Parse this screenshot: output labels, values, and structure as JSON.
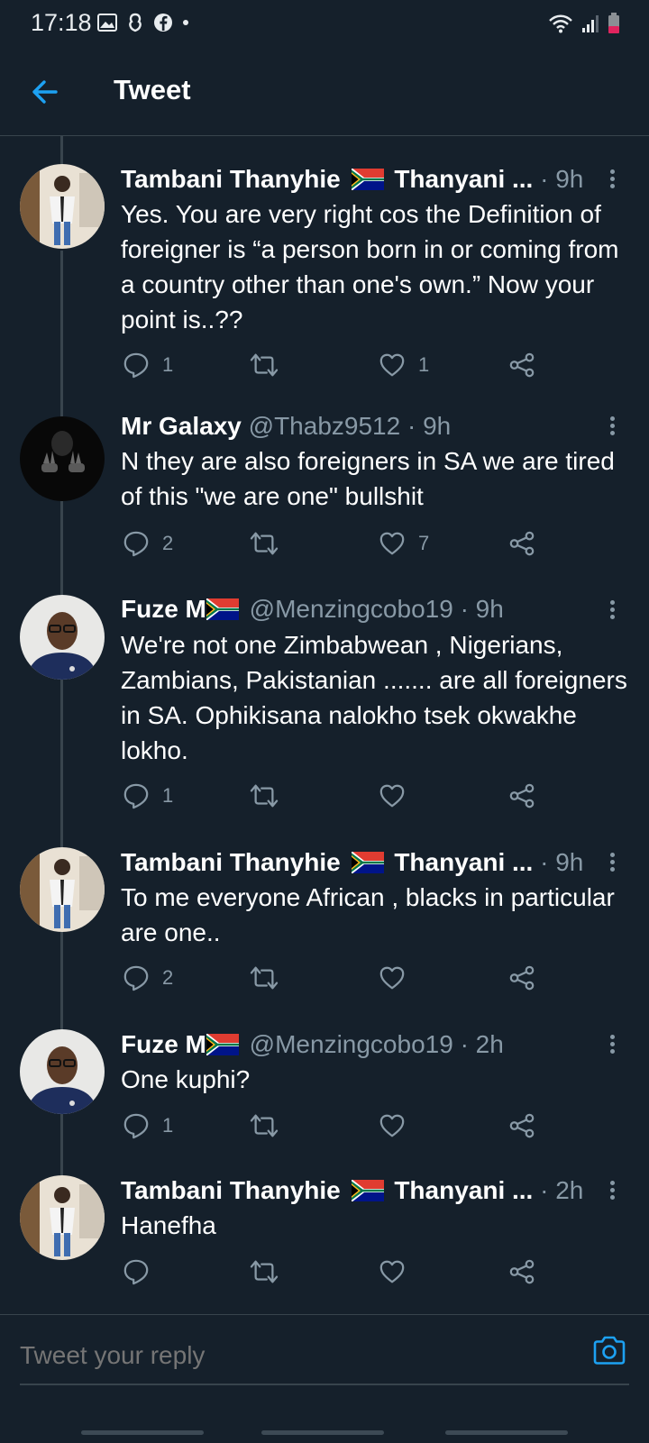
{
  "status_bar": {
    "time": "17:18"
  },
  "header": {
    "title": "Tweet"
  },
  "tweets": [
    {
      "name": "Tambani Thanyhie",
      "name_suffix": "Thanyani ...",
      "handle": "",
      "time": "· 9h",
      "text": "Yes. You are very right cos the Definition of foreigner is “a person born in or coming from a country other than one's own.” Now your point is..??",
      "replies": "1",
      "likes": "1"
    },
    {
      "name": "Mr Galaxy",
      "name_suffix": "",
      "handle": "@Thabz9512",
      "time": "· 9h",
      "text": "N they are also foreigners in SA we are tired of this \"we are one\" bullshit",
      "replies": "2",
      "likes": "7"
    },
    {
      "name": "Fuze M",
      "name_suffix": "",
      "handle": "@Menzingcobo19",
      "time": "· 9h",
      "text": "We're not one Zimbabwean , Nigerians, Zambians, Pakistanian ....... are all foreigners in SA. Ophikisana nalokho tsek okwakhe lokho.",
      "replies": "1",
      "likes": ""
    },
    {
      "name": "Tambani Thanyhie",
      "name_suffix": "Thanyani ...",
      "handle": "",
      "time": "· 9h",
      "text": "To me everyone African , blacks in particular are one..",
      "replies": "2",
      "likes": ""
    },
    {
      "name": "Fuze M",
      "name_suffix": "",
      "handle": "@Menzingcobo19",
      "time": "· 2h",
      "text": "One kuphi?",
      "replies": "1",
      "likes": ""
    },
    {
      "name": "Tambani Thanyhie",
      "name_suffix": "Thanyani ...",
      "handle": "",
      "time": "· 2h",
      "text": "Hanefha",
      "replies": "",
      "likes": ""
    }
  ],
  "reply_bar": {
    "placeholder": "Tweet your reply"
  },
  "colors": {
    "background": "#15202b",
    "accent": "#1da1f2",
    "muted_text": "#8899a6",
    "divider": "#38444d"
  },
  "icons": [
    "back-arrow-icon",
    "reply-icon",
    "retweet-icon",
    "like-icon",
    "share-icon",
    "more-icon",
    "camera-icon",
    "sa-flag-icon"
  ]
}
